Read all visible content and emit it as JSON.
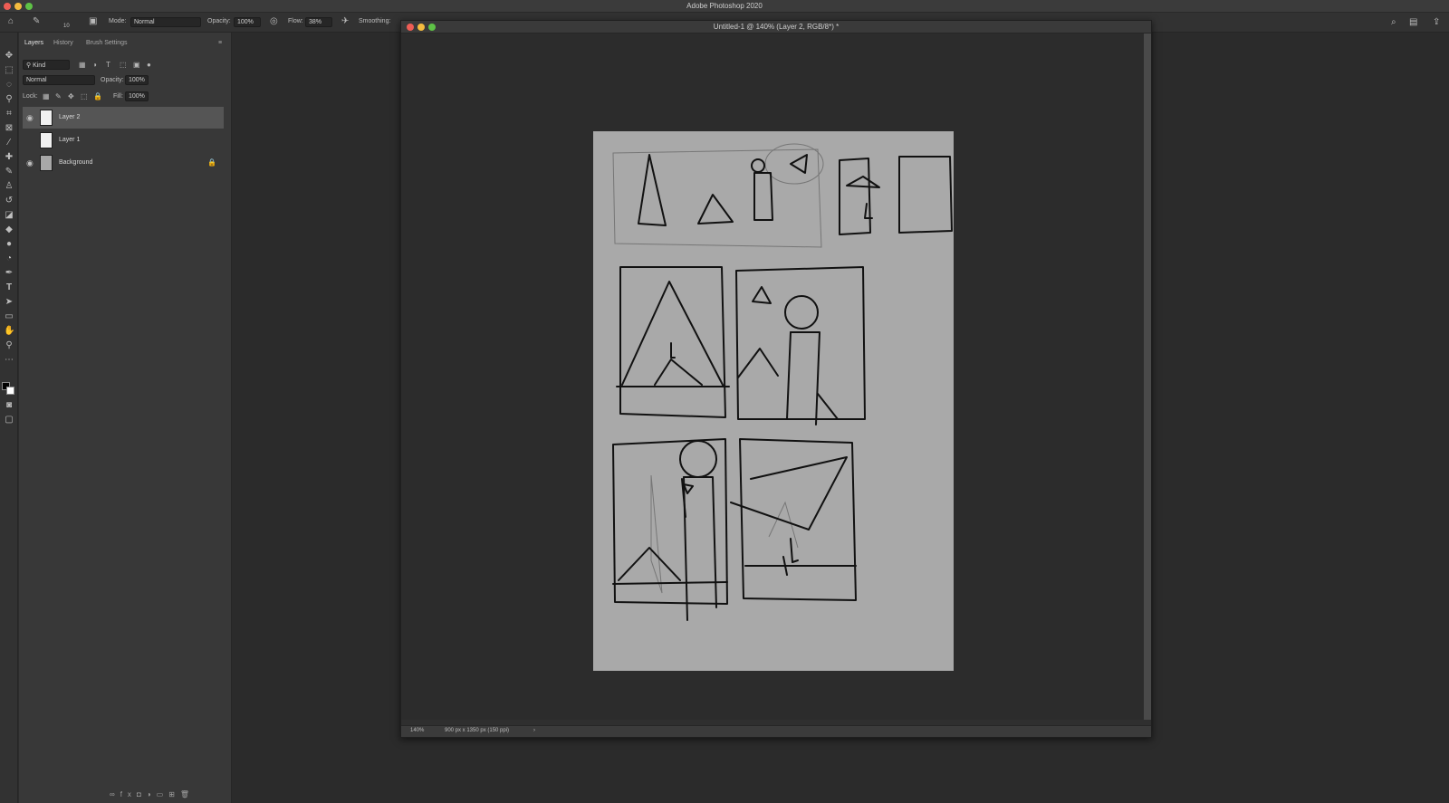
{
  "app": {
    "title": "Adobe Photoshop 2020"
  },
  "options_bar": {
    "mode_label": "Mode:",
    "mode_value": "Normal",
    "opacity_label": "Opacity:",
    "opacity_value": "100%",
    "flow_label": "Flow:",
    "flow_value": "38%",
    "smoothing_label": "Smoothing:",
    "brush_size": "10"
  },
  "panel": {
    "tabs": [
      {
        "label": "Layers"
      },
      {
        "label": "History"
      },
      {
        "label": "Brush Settings"
      }
    ],
    "filter_kind": "Kind",
    "blend_mode": "Normal",
    "opacity_label": "Opacity:",
    "opacity_value": "100%",
    "lock_label": "Lock:",
    "fill_label": "Fill:",
    "fill_value": "100%",
    "layers": [
      {
        "name": "Layer 2",
        "visible": true,
        "selected": true
      },
      {
        "name": "Layer 1",
        "visible": false,
        "selected": false
      },
      {
        "name": "Background",
        "visible": true,
        "selected": false,
        "locked": true
      }
    ]
  },
  "document": {
    "title": "Untitled-1 @ 140% (Layer 2, RGB/8*) *",
    "zoom": "140%",
    "dimensions": "900 px x 1350 px (150 ppi)"
  },
  "colors": {
    "canvas": "#a9a9a9",
    "workspace": "#2c2c2c",
    "panel": "#383838"
  }
}
